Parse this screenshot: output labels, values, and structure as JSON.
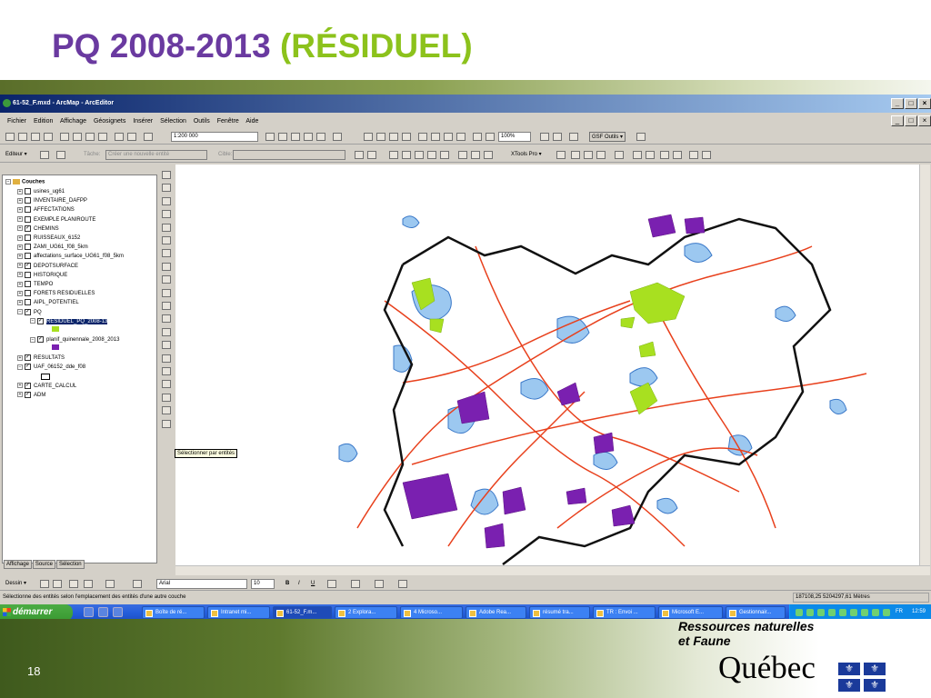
{
  "slide": {
    "title_part1": "PQ 2008-2013",
    "title_part2": "(RÉSIDUEL)",
    "page_number": "18",
    "org_line1": "Ressources naturelles",
    "org_line2": "et Faune",
    "org_brand": "Québec",
    "colors": {
      "title_purple": "#6a3aa0",
      "title_green": "#8cc21c"
    }
  },
  "window": {
    "title": "61-52_F.mxd - ArcMap - ArcEditor",
    "controls": [
      "_",
      "□",
      "×"
    ],
    "second_controls": [
      "_",
      "□",
      "×"
    ]
  },
  "menu": [
    "Fichier",
    "Edition",
    "Affichage",
    "Géosignets",
    "Insérer",
    "Sélection",
    "Outils",
    "Fenêtre",
    "Aide"
  ],
  "toolbar1": {
    "scale": "1:200 000",
    "zoom_percent": "100%",
    "gsf_label": "GSF Outils ▾"
  },
  "toolbar2": {
    "editor_label": "Editeur ▾",
    "task_label": "Tâche:",
    "task_value": "Créer une nouvelle entité",
    "target_label": "Cible:",
    "xtools_label": "XTools Pro ▾"
  },
  "toc": {
    "root": "Couches",
    "layers": [
      {
        "name": "usines_ug61",
        "checked": false,
        "expand": "+"
      },
      {
        "name": "INVENTAIRE_DAFPP",
        "checked": false,
        "expand": "+"
      },
      {
        "name": "AFFECTATIONS",
        "checked": false,
        "expand": "+"
      },
      {
        "name": "EXEMPLE PLANIROUTE",
        "checked": false,
        "expand": "+"
      },
      {
        "name": "CHEMINS",
        "checked": true,
        "expand": "+"
      },
      {
        "name": "RUISSEAUX_6152",
        "checked": false,
        "expand": "+"
      },
      {
        "name": "ZAMI_UG61_f08_5km",
        "checked": false,
        "expand": "+"
      },
      {
        "name": "affectations_surface_UG61_f08_5km",
        "checked": false,
        "expand": "+"
      },
      {
        "name": "DEPOTSURFACE",
        "checked": true,
        "expand": "+"
      },
      {
        "name": "HISTORIQUE",
        "checked": false,
        "expand": "+"
      },
      {
        "name": "TEMPO",
        "checked": false,
        "expand": "+"
      },
      {
        "name": "FORETS RESIDUELLES",
        "checked": false,
        "expand": "+"
      },
      {
        "name": "AIPL_POTENTIEL",
        "checked": false,
        "expand": "+"
      },
      {
        "name": "PQ",
        "checked": true,
        "expand": "−"
      },
      {
        "name": "RESIDUEL_PQ_2008-13",
        "checked": true,
        "expand": "−",
        "sub": true,
        "selected": true
      },
      {
        "name": "planif_quinennale_2008_2013",
        "checked": true,
        "expand": "−",
        "sub": true
      },
      {
        "name": "RESULTATS",
        "checked": true,
        "expand": "+"
      },
      {
        "name": "UAF_06152_dde_f08",
        "checked": true,
        "expand": "−"
      },
      {
        "name": "CARTE_CALCUL",
        "checked": true,
        "expand": "+"
      },
      {
        "name": "ADM",
        "checked": true,
        "expand": "+"
      }
    ],
    "swatch_colors": {
      "residuel": "#a8e020",
      "planif": "#7a20b0",
      "uaf": "#000000"
    },
    "tabs": [
      "Affichage",
      "Source",
      "Sélection"
    ]
  },
  "tooltip": "Sélectionner par entités",
  "map": {
    "legend_colors": {
      "lakes": "#9cc8f0",
      "lake_outline": "#3a78c8",
      "roads": "#e8401c",
      "boundary": "#111111",
      "residuel": "#a8e020",
      "planif": "#7a20b0"
    }
  },
  "drawing_toolbar": {
    "dessin_label": "Dessin ▾",
    "font": "Arial",
    "font_size": "10",
    "style_buttons": [
      "B",
      "I",
      "U"
    ]
  },
  "status": {
    "message": "Sélectionne des entités selon l'emplacement des entités d'une autre couche",
    "coords": "187108,25  5204297,61 Mètres"
  },
  "taskbar": {
    "start": "démarrer",
    "tasks": [
      "Boîte de ré...",
      "Intranet mi...",
      "61-52_F.m...",
      "2 Explora...",
      "4 Microso...",
      "Adobe Rea...",
      "résumé tra...",
      "TR : Envoi ...",
      "Microsoft E...",
      "Gestionnair..."
    ],
    "clock": "12:59",
    "lang": "FR"
  }
}
